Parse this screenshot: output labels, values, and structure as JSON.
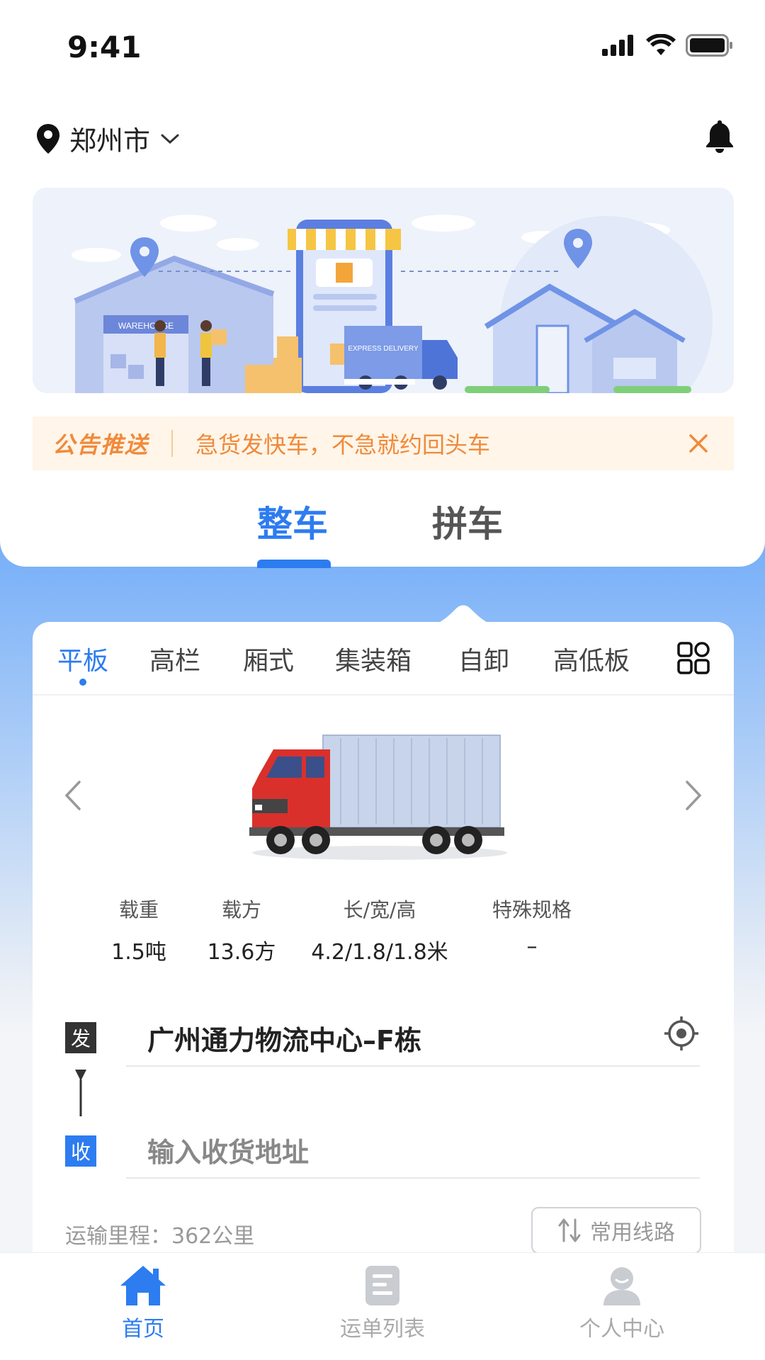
{
  "status_bar": {
    "time": "9:41"
  },
  "header": {
    "city": "郑州市"
  },
  "banner": {
    "warehouse_sign": "WAREHOUSE",
    "truck_text": "EXPRESS DELIVERY"
  },
  "notice": {
    "brand": "公告推送",
    "message": "急货发快车，不急就约回头车"
  },
  "mode_tabs": [
    {
      "label": "整车",
      "active": true
    },
    {
      "label": "拼车",
      "active": false
    }
  ],
  "truck_types": [
    {
      "label": "平板",
      "active": true
    },
    {
      "label": "高栏",
      "active": false
    },
    {
      "label": "厢式",
      "active": false
    },
    {
      "label": "集装箱",
      "active": false
    },
    {
      "label": "自卸",
      "active": false
    },
    {
      "label": "高低板",
      "active": false
    }
  ],
  "specs": [
    {
      "label": "载重",
      "value": "1.5吨"
    },
    {
      "label": "载方",
      "value": "13.6方"
    },
    {
      "label": "长/宽/高",
      "value": "4.2/1.8/1.8米"
    },
    {
      "label": "特殊规格",
      "value": "–"
    }
  ],
  "address": {
    "from_tag": "发",
    "to_tag": "收",
    "from_value": "广州通力物流中心–F栋",
    "to_placeholder": "输入收货地址"
  },
  "mileage": {
    "text": "运输里程：362公里"
  },
  "route_button": {
    "label": "常用线路"
  },
  "bottom_nav": [
    {
      "label": "首页",
      "active": true
    },
    {
      "label": "运单列表",
      "active": false
    },
    {
      "label": "个人中心",
      "active": false
    }
  ],
  "colors": {
    "primary": "#2d7cf0",
    "notice_bg": "#fff5e8",
    "notice_text": "#ef8a3b",
    "truck_cab": "#d9302c"
  }
}
